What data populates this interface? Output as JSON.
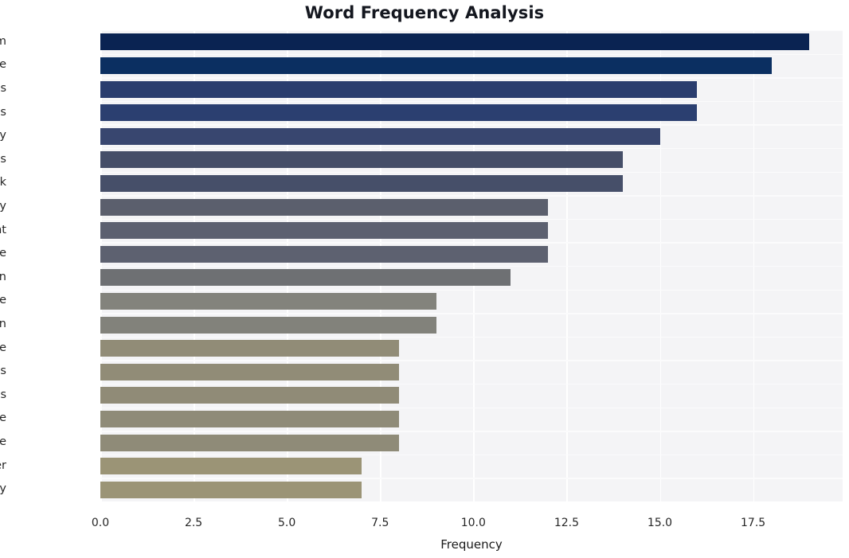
{
  "chart_data": {
    "type": "bar",
    "orientation": "horizontal",
    "title": "Word Frequency Analysis",
    "xlabel": "Frequency",
    "ylabel": "",
    "categories": [
      "team",
      "ensure",
      "business",
      "process",
      "technology",
      "crisis",
      "risk",
      "company",
      "management",
      "people",
      "plan",
      "software",
      "communication",
      "update",
      "disruptions",
      "continuous",
      "structure",
      "include",
      "disaster",
      "continuity"
    ],
    "values": [
      19,
      18,
      16,
      16,
      15,
      14,
      14,
      12,
      12,
      12,
      11,
      9,
      9,
      8,
      8,
      8,
      8,
      8,
      7,
      7
    ],
    "bar_colors": [
      "#0a2352",
      "#0b2f61",
      "#2a3d6e",
      "#2b3f70",
      "#38466f",
      "#454e68",
      "#464f69",
      "#5b5f6d",
      "#5c6070",
      "#5d6170",
      "#6e7073",
      "#83837c",
      "#82827b",
      "#918c77",
      "#918c77",
      "#908b77",
      "#8f8b78",
      "#8f8b78",
      "#9b9476",
      "#9b9476"
    ],
    "xticks": [
      "0.0",
      "2.5",
      "5.0",
      "7.5",
      "10.0",
      "12.5",
      "15.0",
      "17.5"
    ],
    "xtick_values": [
      0,
      2.5,
      5,
      7.5,
      10,
      12.5,
      15,
      17.5
    ],
    "xlim": [
      0,
      19.9
    ],
    "grid": true,
    "legend": false,
    "style": {
      "plot_background": "#f4f4f6",
      "figure_background": "#ffffff",
      "gridline_color": "#ffffff",
      "title_color": "#14171f",
      "tick_label_color": "#262626"
    }
  }
}
